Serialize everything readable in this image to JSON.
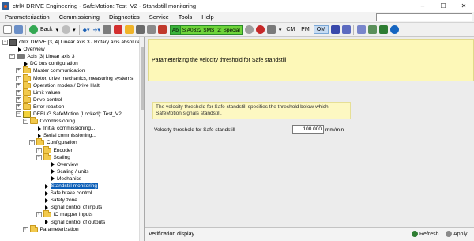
{
  "window": {
    "title": "ctrlX DRIVE Engineering - SafeMotion: Test_V2 - Standstill monitoring",
    "controls": [
      "–",
      "☐",
      "✕"
    ]
  },
  "menu": [
    "Parameterization",
    "Commissioning",
    "Diagnostics",
    "Service",
    "Tools",
    "Help"
  ],
  "toolbar": {
    "back_label": "Back",
    "status_code": "Ab",
    "status_text": "S A0322 SMST2: Special",
    "modes": [
      "CM",
      "PM",
      "OM"
    ],
    "active_mode": "OM"
  },
  "tree": [
    {
      "label": "ctrlX DRIVE [3, 4] Linear axis 3 / Rotary axis absolute",
      "indent": 0,
      "exp": "−",
      "icon": "drive-icon"
    },
    {
      "label": "Overview",
      "indent": 1,
      "exp": "",
      "icon": "arrow-icon"
    },
    {
      "label": "Axis [3] Linear axis 3",
      "indent": 1,
      "exp": "−",
      "icon": "axis-icon"
    },
    {
      "label": "DC bus configuration",
      "indent": 2,
      "exp": "",
      "icon": "arrow-icon"
    },
    {
      "label": "Master communication",
      "indent": 2,
      "exp": "+",
      "icon": "folder-icon"
    },
    {
      "label": "Motor, drive mechanics, measuring systems",
      "indent": 2,
      "exp": "+",
      "icon": "folder-icon"
    },
    {
      "label": "Operation modes / Drive Halt",
      "indent": 2,
      "exp": "+",
      "icon": "folder-icon"
    },
    {
      "label": "Limit values",
      "indent": 2,
      "exp": "+",
      "icon": "folder-icon"
    },
    {
      "label": "Drive control",
      "indent": 2,
      "exp": "+",
      "icon": "folder-icon"
    },
    {
      "label": "Error reaction",
      "indent": 2,
      "exp": "+",
      "icon": "folder-icon"
    },
    {
      "label": "DEBUG SafeMotion (Locked): Test_V2",
      "indent": 2,
      "exp": "−",
      "icon": "debug-icon"
    },
    {
      "label": "Commissioning",
      "indent": 3,
      "exp": "−",
      "icon": "folder-icon"
    },
    {
      "label": "Initial commissioning...",
      "indent": 4,
      "exp": "",
      "icon": "arrow-icon"
    },
    {
      "label": "Serial commissioning...",
      "indent": 4,
      "exp": "",
      "icon": "arrow-icon"
    },
    {
      "label": "Configuration",
      "indent": 4,
      "exp": "−",
      "icon": "folder-icon"
    },
    {
      "label": "Encoder",
      "indent": 5,
      "exp": "+",
      "icon": "folder-icon"
    },
    {
      "label": "Scaling",
      "indent": 5,
      "exp": "−",
      "icon": "folder-icon"
    },
    {
      "label": "Overview",
      "indent": 6,
      "exp": "",
      "icon": "arrow-icon"
    },
    {
      "label": "Scaling / units",
      "indent": 6,
      "exp": "",
      "icon": "arrow-icon"
    },
    {
      "label": "Mechanics",
      "indent": 6,
      "exp": "",
      "icon": "arrow-icon"
    },
    {
      "label": "Standstill monitoring",
      "indent": 5,
      "exp": "",
      "icon": "arrow-icon",
      "selected": true
    },
    {
      "label": "Safe brake control",
      "indent": 5,
      "exp": "",
      "icon": "arrow-icon"
    },
    {
      "label": "Safety zone",
      "indent": 5,
      "exp": "",
      "icon": "arrow-icon"
    },
    {
      "label": "Signal control of inputs",
      "indent": 5,
      "exp": "",
      "icon": "arrow-icon"
    },
    {
      "label": "IO mapper inputs",
      "indent": 5,
      "exp": "+",
      "icon": "folder-icon"
    },
    {
      "label": "Signal control of outputs",
      "indent": 5,
      "exp": "",
      "icon": "arrow-icon"
    },
    {
      "label": "Parameterization",
      "indent": 3,
      "exp": "+",
      "icon": "folder-icon"
    }
  ],
  "main": {
    "header_text": "Parameterizing the velocity threshold for Safe standstill",
    "description": "The velocity threshold for Safe standstill specifies the threshold below which SafeMotion signals standstill.",
    "param_label": "Velocity threshold for Safe standstill",
    "param_value": "100.000",
    "param_unit": "mm/min"
  },
  "bottom": {
    "verification_label": "Verification display",
    "refresh_label": "Refresh",
    "apply_label": "Apply"
  }
}
